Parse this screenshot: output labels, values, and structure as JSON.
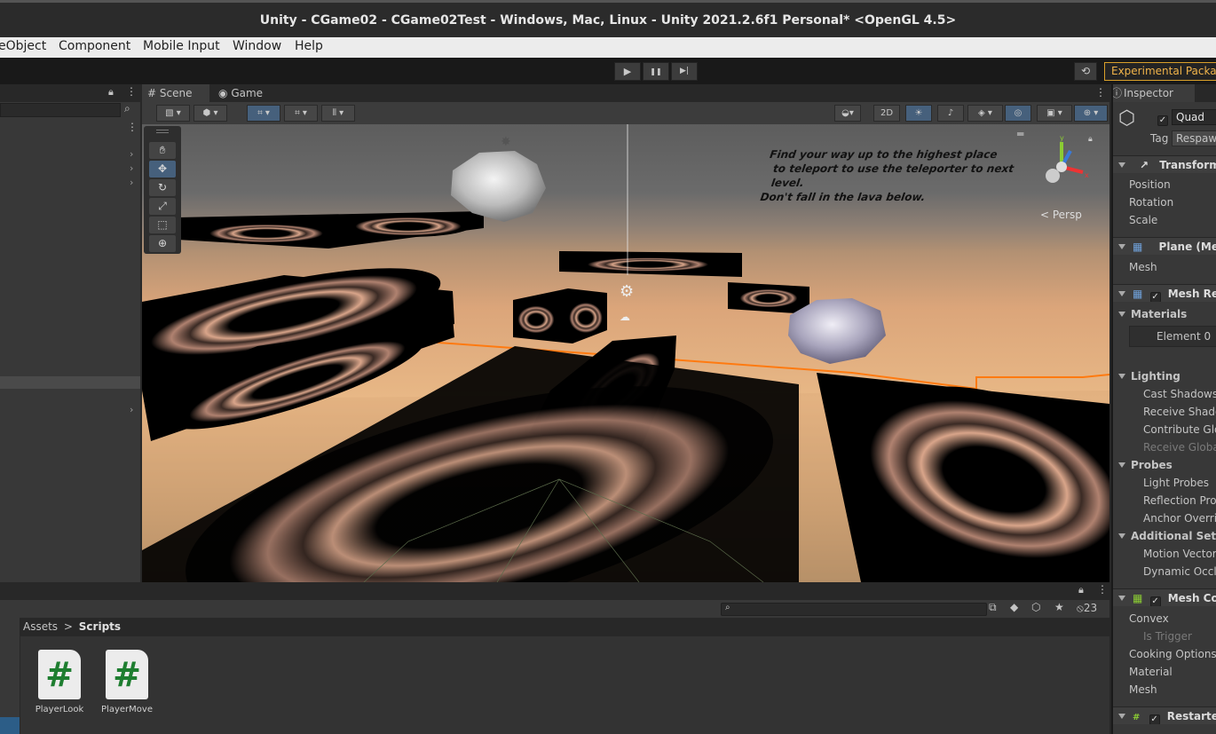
{
  "window": {
    "title": "Unity - CGame02 - CGame02Test - Windows, Mac, Linux - Unity 2021.2.6f1 Personal* <OpenGL 4.5>"
  },
  "menu": {
    "items": [
      "eObject",
      "Component",
      "Mobile Input",
      "Window",
      "Help"
    ]
  },
  "toolbar": {
    "play_glyph": "▶",
    "pause_glyph": "❚❚",
    "step_glyph": "▶|",
    "history_glyph": "⟲",
    "experimental_label": "Experimental Packages"
  },
  "scene": {
    "tabs": [
      "Scene",
      "Game"
    ],
    "toggle_2d": "2D",
    "hint_line1": "Find your way up to the highest place",
    "hint_line2": "to teleport to use the teleporter to next level.",
    "hint_line3": "Don't fall in the lava below.",
    "persp_label": "< Persp"
  },
  "project": {
    "breadcrumb_root": "Assets",
    "breadcrumb_sep": ">",
    "breadcrumb_current": "Scripts",
    "hidden_count": "23",
    "assets": [
      {
        "name": "PlayerLook",
        "glyph": "#"
      },
      {
        "name": "PlayerMove",
        "glyph": "#"
      }
    ]
  },
  "inspector": {
    "tab": "Inspector",
    "object_name": "Quad",
    "tag_label": "Tag",
    "tag_value": "Respawn",
    "rows": {
      "transform": "Transform",
      "position": "Position",
      "rotation": "Rotation",
      "scale": "Scale",
      "plane": "Plane (Mesh Filter)",
      "mesh": "Mesh",
      "mesh_renderer": "Mesh Renderer",
      "materials": "Materials",
      "element0": "Element 0",
      "lighting": "Lighting",
      "cast_shadows": "Cast Shadows",
      "receive_shadows": "Receive Shadows",
      "contribute_gi": "Contribute Global Illumination",
      "receive_gi": "Receive Global Illumination",
      "probes": "Probes",
      "light_probes": "Light Probes",
      "reflection_probes": "Reflection Probes",
      "anchor_override": "Anchor Override",
      "additional": "Additional Settings",
      "motion_vectors": "Motion Vectors",
      "dynamic_occlusion": "Dynamic Occlusion",
      "mesh_collider": "Mesh Collider",
      "convex": "Convex",
      "is_trigger": "Is Trigger",
      "cooking": "Cooking Options",
      "material": "Material",
      "mesh2": "Mesh",
      "restarter": "Restarter"
    }
  },
  "colors": {
    "accent": "#46607c",
    "experimental": "#f0b34a",
    "selection": "#2c5d87",
    "script_icon": "#1e7e30"
  }
}
